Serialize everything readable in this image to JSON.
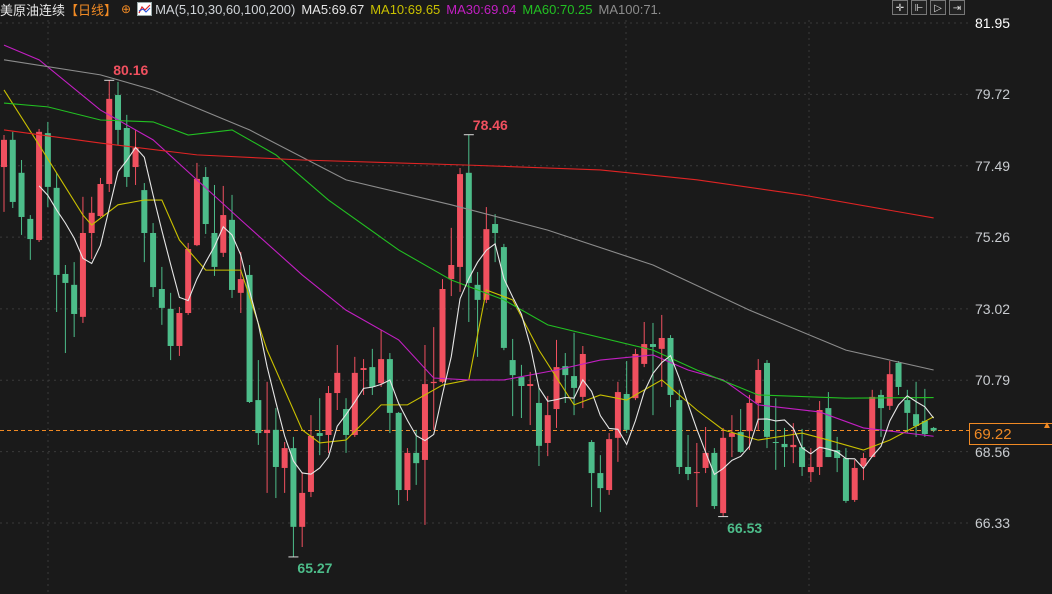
{
  "header": {
    "title": "美原油连续",
    "period": "【日线】",
    "ma_params": "MA(5,10,30,60,100,200)",
    "ma5": "MA5:69.67",
    "ma10": "MA10:69.65",
    "ma30": "MA30:69.04",
    "ma60": "MA60:70.25",
    "ma100": "MA100:71."
  },
  "toolbar": {
    "icons": [
      "crosshair-icon",
      "zoom-in-icon",
      "play-icon",
      "exit-icon"
    ]
  },
  "colors": {
    "up": "#f0505f",
    "down": "#4dbd8a",
    "ma5": "#e6e6e6",
    "ma10": "#c9c000",
    "ma30": "#c21fc2",
    "ma60": "#22c022",
    "ma100": "#8c8c8c",
    "ma200": "#e02424",
    "accent": "#f08a24"
  },
  "chart_data": {
    "type": "candlestick",
    "title": "美原油连续 日线",
    "ohlc_order": [
      "open",
      "close",
      "high",
      "low"
    ],
    "ylim": [
      64.5,
      81.95
    ],
    "y_ticks": [
      "81.95",
      "79.72",
      "77.49",
      "75.26",
      "73.02",
      "70.79",
      "68.56",
      "66.33"
    ],
    "y_tick_values": [
      81.95,
      79.72,
      77.49,
      75.26,
      73.02,
      70.79,
      68.56,
      66.33
    ],
    "grid": true,
    "last_price": "69.22",
    "annotations": [
      {
        "label": "80.16",
        "index": 12,
        "value": 80.16,
        "kind": "high"
      },
      {
        "label": "78.46",
        "index": 53,
        "value": 78.46,
        "kind": "high"
      },
      {
        "label": "65.27",
        "index": 33,
        "value": 65.27,
        "kind": "low"
      },
      {
        "label": "66.53",
        "index": 82,
        "value": 66.53,
        "kind": "low"
      }
    ],
    "candles": [
      [
        77.45,
        78.3,
        78.45,
        76.05
      ],
      [
        78.3,
        76.36,
        78.55,
        76.17
      ],
      [
        77.27,
        75.89,
        77.67,
        75.33
      ],
      [
        75.83,
        75.2,
        75.95,
        74.55
      ],
      [
        75.17,
        78.55,
        78.64,
        75.11
      ],
      [
        78.51,
        76.83,
        78.86,
        76.2
      ],
      [
        76.8,
        74.08,
        77.27,
        72.92
      ],
      [
        74.11,
        73.83,
        74.39,
        71.64
      ],
      [
        73.77,
        72.86,
        74.48,
        72.14
      ],
      [
        72.77,
        75.39,
        76.52,
        72.58
      ],
      [
        75.39,
        76.02,
        76.52,
        74.58
      ],
      [
        75.92,
        76.92,
        77.11,
        75.89
      ],
      [
        76.92,
        79.58,
        80.16,
        76.67
      ],
      [
        79.7,
        78.61,
        80.11,
        78.14
      ],
      [
        78.67,
        77.14,
        79.08,
        76.83
      ],
      [
        77.45,
        78.05,
        78.61,
        76.89
      ],
      [
        76.73,
        75.39,
        76.95,
        74.48
      ],
      [
        75.39,
        73.7,
        75.7,
        73.39
      ],
      [
        73.64,
        73.05,
        74.33,
        72.52
      ],
      [
        73.02,
        71.86,
        73.52,
        71.42
      ],
      [
        71.86,
        72.89,
        73.08,
        71.55
      ],
      [
        72.89,
        74.89,
        75.08,
        72.83
      ],
      [
        75.01,
        77.08,
        77.58,
        74.98
      ],
      [
        77.14,
        75.67,
        77.45,
        75.36
      ],
      [
        75.39,
        74.33,
        76.89,
        74.05
      ],
      [
        74.77,
        75.95,
        76.86,
        74.64
      ],
      [
        75.8,
        73.61,
        76.58,
        73.36
      ],
      [
        73.52,
        73.95,
        74.8,
        72.89
      ],
      [
        74.08,
        70.11,
        74.39,
        70.08
      ],
      [
        70.17,
        69.14,
        71.42,
        68.77
      ],
      [
        69.14,
        69.24,
        70.74,
        67.27
      ],
      [
        69.24,
        68.08,
        69.92,
        67.11
      ],
      [
        68.05,
        68.67,
        68.86,
        67.27
      ],
      [
        68.67,
        66.21,
        69.02,
        65.27
      ],
      [
        66.21,
        67.27,
        67.92,
        65.58
      ],
      [
        67.3,
        69.05,
        69.7,
        67.14
      ],
      [
        69.14,
        69.05,
        70.23,
        68.45
      ],
      [
        69.08,
        70.39,
        70.61,
        68.52
      ],
      [
        70.39,
        71.02,
        71.89,
        69.86
      ],
      [
        69.89,
        69.08,
        70.23,
        68.52
      ],
      [
        69.08,
        71.02,
        71.52,
        69.02
      ],
      [
        71.11,
        71.17,
        71.45,
        70.33
      ],
      [
        71.2,
        70.58,
        71.77,
        70.33
      ],
      [
        70.7,
        71.45,
        72.36,
        70.58
      ],
      [
        71.45,
        69.77,
        71.64,
        69.14
      ],
      [
        69.77,
        67.36,
        69.8,
        66.89
      ],
      [
        67.36,
        68.52,
        68.67,
        67.02
      ],
      [
        68.52,
        68.2,
        69.24,
        67.52
      ],
      [
        68.3,
        70.67,
        71.89,
        66.27
      ],
      [
        70.7,
        70.74,
        72.45,
        69.24
      ],
      [
        70.74,
        73.64,
        73.95,
        70.7
      ],
      [
        73.95,
        74.39,
        75.55,
        73.42
      ],
      [
        74.33,
        77.23,
        77.42,
        73.55
      ],
      [
        77.27,
        73.83,
        78.46,
        72.61
      ],
      [
        73.77,
        73.3,
        74.17,
        71.52
      ],
      [
        73.3,
        75.51,
        76.2,
        73.2
      ],
      [
        75.67,
        75.39,
        75.98,
        74.48
      ],
      [
        74.95,
        71.8,
        75.05,
        71.73
      ],
      [
        71.42,
        70.95,
        72.08,
        69.67
      ],
      [
        70.89,
        70.61,
        71.27,
        69.61
      ],
      [
        70.61,
        70.67,
        71.05,
        69.39
      ],
      [
        70.08,
        68.74,
        70.55,
        68.11
      ],
      [
        68.83,
        69.7,
        70.3,
        68.42
      ],
      [
        69.89,
        71.2,
        72.05,
        69.3
      ],
      [
        71.23,
        70.95,
        71.64,
        70.08
      ],
      [
        70.92,
        70.55,
        72.27,
        69.7
      ],
      [
        70.27,
        71.61,
        71.86,
        69.92
      ],
      [
        68.86,
        67.89,
        68.92,
        66.83
      ],
      [
        67.89,
        67.42,
        68.45,
        66.67
      ],
      [
        67.36,
        68.95,
        69.14,
        67.21
      ],
      [
        68.99,
        70.42,
        70.74,
        68.24
      ],
      [
        70.36,
        69.24,
        71.39,
        69.14
      ],
      [
        70.23,
        71.61,
        71.77,
        70.17
      ],
      [
        71.3,
        71.92,
        72.61,
        71.2
      ],
      [
        71.92,
        71.83,
        72.58,
        69.7
      ],
      [
        71.77,
        72.11,
        72.83,
        70.58
      ],
      [
        72.11,
        70.33,
        72.2,
        69.95
      ],
      [
        70.17,
        68.08,
        70.49,
        67.86
      ],
      [
        68.08,
        67.86,
        69.08,
        67.67
      ],
      [
        67.89,
        67.92,
        68.83,
        66.83
      ],
      [
        68.05,
        68.52,
        69.33,
        67.89
      ],
      [
        68.52,
        66.86,
        68.67,
        66.77
      ],
      [
        66.64,
        68.99,
        69.3,
        66.53
      ],
      [
        69.02,
        69.14,
        69.7,
        68.39
      ],
      [
        69.17,
        68.55,
        69.89,
        68.52
      ],
      [
        69.2,
        70.08,
        70.33,
        68.61
      ],
      [
        70.08,
        71.11,
        71.45,
        69.24
      ],
      [
        71.33,
        69.02,
        71.42,
        68.67
      ],
      [
        68.86,
        68.83,
        70.23,
        67.99
      ],
      [
        68.8,
        68.7,
        69.3,
        68.08
      ],
      [
        68.7,
        68.77,
        69.45,
        68.2
      ],
      [
        68.7,
        68.08,
        69.27,
        67.8
      ],
      [
        67.92,
        68.08,
        68.67,
        67.61
      ],
      [
        68.08,
        69.86,
        70.14,
        67.83
      ],
      [
        69.92,
        68.39,
        70.42,
        68.39
      ],
      [
        68.61,
        68.36,
        69.02,
        67.92
      ],
      [
        68.36,
        67.02,
        68.67,
        66.96
      ],
      [
        67.05,
        68.05,
        68.3,
        66.99
      ],
      [
        68.11,
        68.36,
        68.52,
        67.67
      ],
      [
        68.39,
        70.27,
        70.49,
        68.39
      ],
      [
        70.33,
        69.92,
        70.49,
        69.02
      ],
      [
        69.99,
        70.98,
        71.39,
        69.86
      ],
      [
        71.33,
        70.58,
        71.39,
        70.33
      ],
      [
        70.17,
        69.77,
        70.49,
        69.14
      ],
      [
        69.73,
        69.36,
        70.74,
        69.02
      ],
      [
        69.52,
        69.11,
        70.52,
        69.02
      ],
      [
        69.3,
        69.22,
        69.33,
        69.17
      ]
    ],
    "ma_series": [
      {
        "name": "MA10",
        "color": "#c9c000",
        "points": [
          [
            0,
            79.86
          ],
          [
            4,
            78.14
          ],
          [
            9,
            75.95
          ],
          [
            10,
            75.64
          ],
          [
            13,
            76.27
          ],
          [
            16,
            76.42
          ],
          [
            18,
            76.42
          ],
          [
            20,
            75.17
          ],
          [
            23,
            74.23
          ],
          [
            27,
            74.23
          ],
          [
            30,
            71.73
          ],
          [
            34,
            69.24
          ],
          [
            36,
            68.83
          ],
          [
            39,
            68.92
          ],
          [
            43,
            70.02
          ],
          [
            46,
            70.02
          ],
          [
            50,
            70.64
          ],
          [
            53,
            70.8
          ],
          [
            55,
            73.61
          ],
          [
            58,
            73.3
          ],
          [
            61,
            71.73
          ],
          [
            65,
            70.02
          ],
          [
            68,
            70.33
          ],
          [
            71,
            70.17
          ],
          [
            75,
            70.8
          ],
          [
            79,
            69.86
          ],
          [
            82,
            69.24
          ],
          [
            86,
            68.92
          ],
          [
            91,
            69.14
          ],
          [
            94,
            68.92
          ],
          [
            98,
            68.61
          ],
          [
            101,
            68.92
          ],
          [
            106,
            69.65
          ]
        ]
      },
      {
        "name": "MA30",
        "color": "#c21fc2",
        "points": [
          [
            0,
            81.26
          ],
          [
            4,
            80.8
          ],
          [
            11,
            79.23
          ],
          [
            17,
            78.3
          ],
          [
            22,
            77.05
          ],
          [
            27,
            75.8
          ],
          [
            34,
            74.08
          ],
          [
            39,
            72.98
          ],
          [
            45,
            72.05
          ],
          [
            49,
            70.86
          ],
          [
            53,
            70.8
          ],
          [
            57,
            70.8
          ],
          [
            63,
            71.11
          ],
          [
            68,
            71.42
          ],
          [
            74,
            71.58
          ],
          [
            78,
            71.11
          ],
          [
            82,
            70.8
          ],
          [
            86,
            70.02
          ],
          [
            93,
            69.8
          ],
          [
            98,
            69.3
          ],
          [
            106,
            69.04
          ]
        ]
      },
      {
        "name": "MA60",
        "color": "#22c022",
        "points": [
          [
            0,
            79.45
          ],
          [
            5,
            79.33
          ],
          [
            11,
            78.92
          ],
          [
            17,
            78.86
          ],
          [
            21,
            78.45
          ],
          [
            26,
            78.61
          ],
          [
            31,
            77.83
          ],
          [
            37,
            76.42
          ],
          [
            45,
            74.86
          ],
          [
            51,
            73.92
          ],
          [
            57,
            73.3
          ],
          [
            62,
            72.52
          ],
          [
            74,
            71.73
          ],
          [
            79,
            71.11
          ],
          [
            86,
            70.33
          ],
          [
            96,
            70.23
          ],
          [
            106,
            70.25
          ]
        ]
      },
      {
        "name": "MA100",
        "color": "#8c8c8c",
        "points": [
          [
            0,
            80.8
          ],
          [
            11,
            80.33
          ],
          [
            17,
            79.86
          ],
          [
            28,
            78.61
          ],
          [
            39,
            77.05
          ],
          [
            51,
            76.27
          ],
          [
            62,
            75.48
          ],
          [
            74,
            74.39
          ],
          [
            85,
            72.98
          ],
          [
            96,
            71.73
          ],
          [
            106,
            71.11
          ]
        ]
      },
      {
        "name": "MA200",
        "color": "#e02424",
        "points": [
          [
            0,
            78.61
          ],
          [
            11,
            78.2
          ],
          [
            22,
            77.83
          ],
          [
            34,
            77.67
          ],
          [
            53,
            77.51
          ],
          [
            68,
            77.36
          ],
          [
            79,
            77.05
          ],
          [
            91,
            76.58
          ],
          [
            106,
            75.86
          ]
        ]
      }
    ]
  }
}
